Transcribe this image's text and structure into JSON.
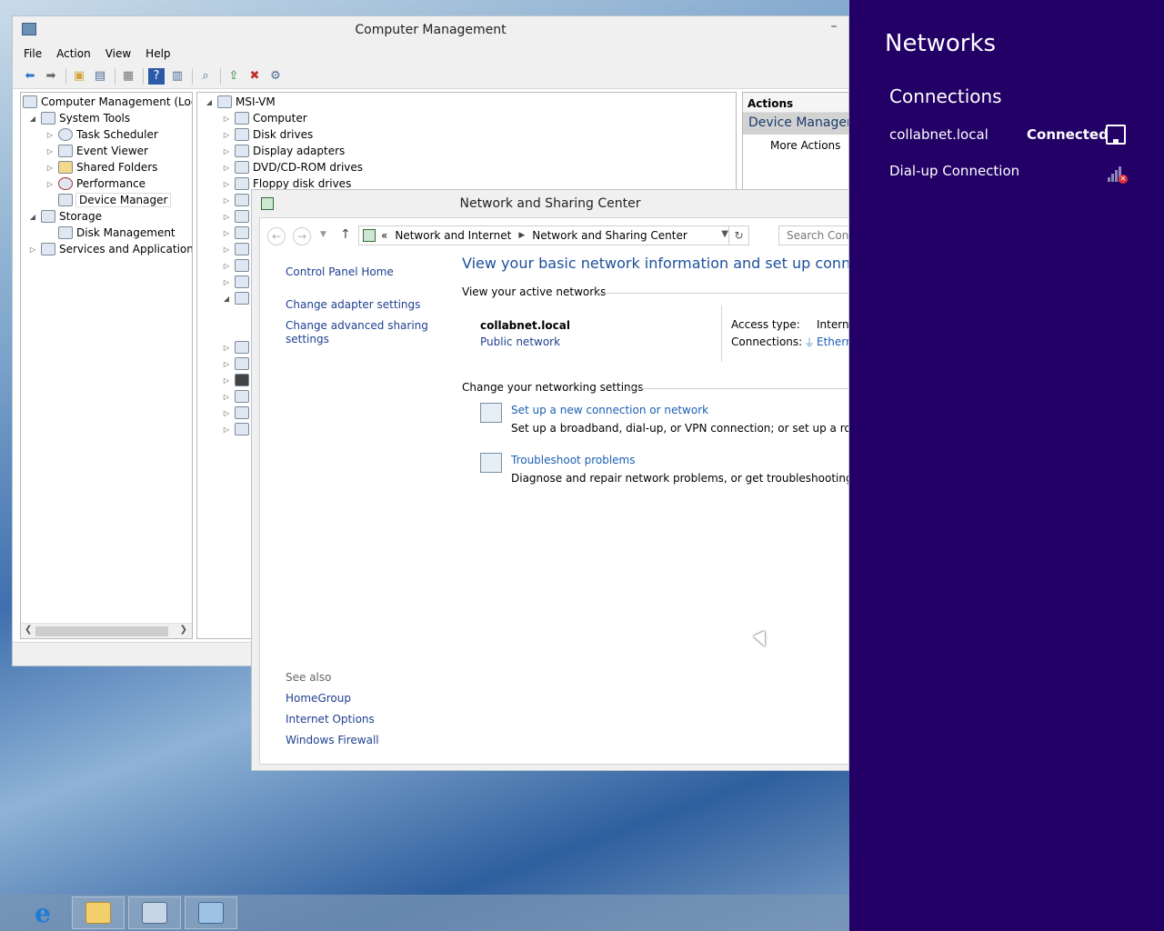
{
  "computer_management": {
    "title": "Computer Management",
    "menu": [
      "File",
      "Action",
      "View",
      "Help"
    ],
    "left_tree": [
      {
        "label": "Computer Management (Local",
        "level": 0,
        "expander": ""
      },
      {
        "label": "System Tools",
        "level": 1,
        "expander": "◢"
      },
      {
        "label": "Task Scheduler",
        "level": 2,
        "expander": "▷"
      },
      {
        "label": "Event Viewer",
        "level": 2,
        "expander": "▷"
      },
      {
        "label": "Shared Folders",
        "level": 2,
        "expander": "▷"
      },
      {
        "label": "Performance",
        "level": 2,
        "expander": "▷"
      },
      {
        "label": "Device Manager",
        "level": 2,
        "expander": ""
      },
      {
        "label": "Storage",
        "level": 1,
        "expander": "◢"
      },
      {
        "label": "Disk Management",
        "level": 2,
        "expander": ""
      },
      {
        "label": "Services and Applications",
        "level": 1,
        "expander": "▷"
      }
    ],
    "device_tree_root": "MSI-VM",
    "device_tree": [
      "Computer",
      "Disk drives",
      "Display adapters",
      "DVD/CD-ROM drives",
      "Floppy disk drives"
    ],
    "actions_header": "Actions",
    "actions_subheader": "Device Manager",
    "more_actions": "More Actions"
  },
  "network_center": {
    "title": "Network and Sharing Center",
    "breadcrumb": [
      "Network and Internet",
      "Network and Sharing Center"
    ],
    "breadcrumb_prefix": "«",
    "search_placeholder": "Search Contro",
    "sidebar": {
      "home": "Control Panel Home",
      "adapter": "Change adapter settings",
      "advanced_line1": "Change advanced sharing",
      "advanced_line2": "settings",
      "see_also": "See also",
      "links": [
        "HomeGroup",
        "Internet Options",
        "Windows Firewall"
      ]
    },
    "heading": "View your basic network information and set up connections",
    "active_networks_label": "View your active networks",
    "network_name": "collabnet.local",
    "network_type": "Public network",
    "access_type_label": "Access type:",
    "access_type_value": "Interne",
    "connections_label": "Connections:",
    "connections_value": "Etherne",
    "change_settings_label": "Change your networking settings",
    "setup_link": "Set up a new connection or network",
    "setup_desc": "Set up a broadband, dial-up, or VPN connection; or set up a router or a",
    "troubleshoot_link": "Troubleshoot problems",
    "troubleshoot_desc": "Diagnose and repair network problems, or get troubleshooting informa"
  },
  "networks_flyout": {
    "title": "Networks",
    "section": "Connections",
    "connection_name": "collabnet.local",
    "connection_status": "Connected",
    "dialup_name": "Dial-up Connection",
    "background_color": "#220066"
  },
  "taskbar": {
    "apps": [
      "internet-explorer-icon",
      "file-explorer-icon",
      "computer-management-icon",
      "control-panel-icon"
    ]
  }
}
